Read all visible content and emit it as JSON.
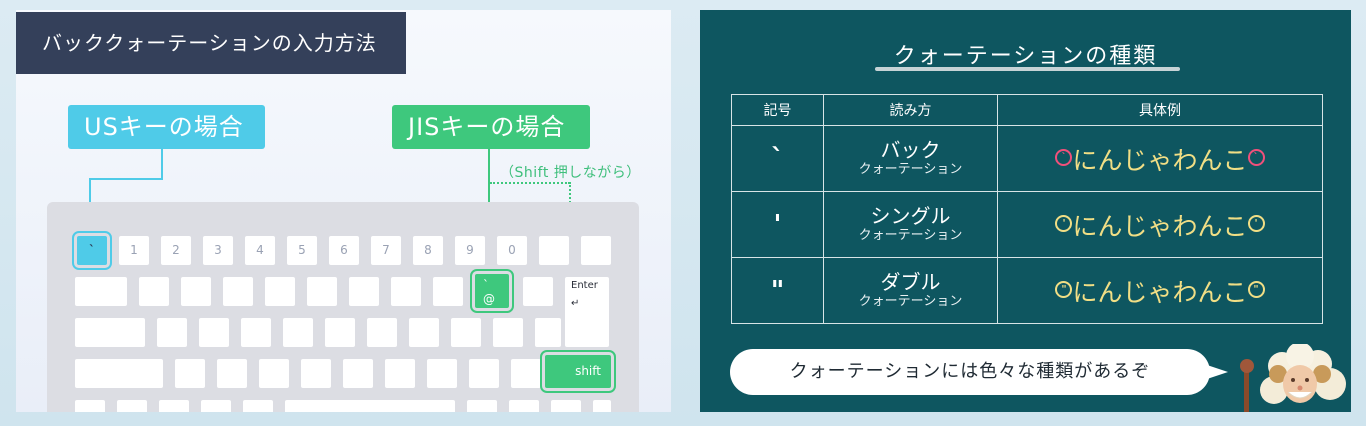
{
  "left": {
    "title": "バッククォーテーションの入力方法",
    "us_tag": "USキーの場合",
    "jis_tag": "JISキーの場合",
    "shift_note": "（Shift 押しながら）",
    "keyboard": {
      "number_row": [
        "`",
        "1",
        "2",
        "3",
        "4",
        "5",
        "6",
        "7",
        "8",
        "9",
        "0",
        "",
        ""
      ],
      "at_key_top": "`",
      "at_key_bottom": "@",
      "enter_label": "Enter ↵",
      "shift_label": "shift"
    }
  },
  "right": {
    "title": "クォーテーションの種類",
    "table": {
      "headers": [
        "記号",
        "読み方",
        "具体例"
      ],
      "rows": [
        {
          "symbol": "`",
          "read_main": "バック",
          "read_sub": "クォーテーション",
          "example": "にんじゃわんこ",
          "badge": "`"
        },
        {
          "symbol": "'",
          "read_main": "シングル",
          "read_sub": "クォーテーション",
          "example": "にんじゃわんこ",
          "badge": "'"
        },
        {
          "symbol": "\"",
          "read_main": "ダブル",
          "read_sub": "クォーテーション",
          "example": "にんじゃわんこ",
          "badge": "\""
        }
      ]
    },
    "bubble": "クォーテーションには色々な種類があるぞ",
    "mascot_icon": "sheep-mascot-icon"
  },
  "colors": {
    "left_title_bg": "#34405a",
    "us_accent": "#4fcbe8",
    "jis_accent": "#3ec87d",
    "right_bg": "#0e5660",
    "example_text": "#f1de85",
    "back_badge": "#f0507b"
  }
}
